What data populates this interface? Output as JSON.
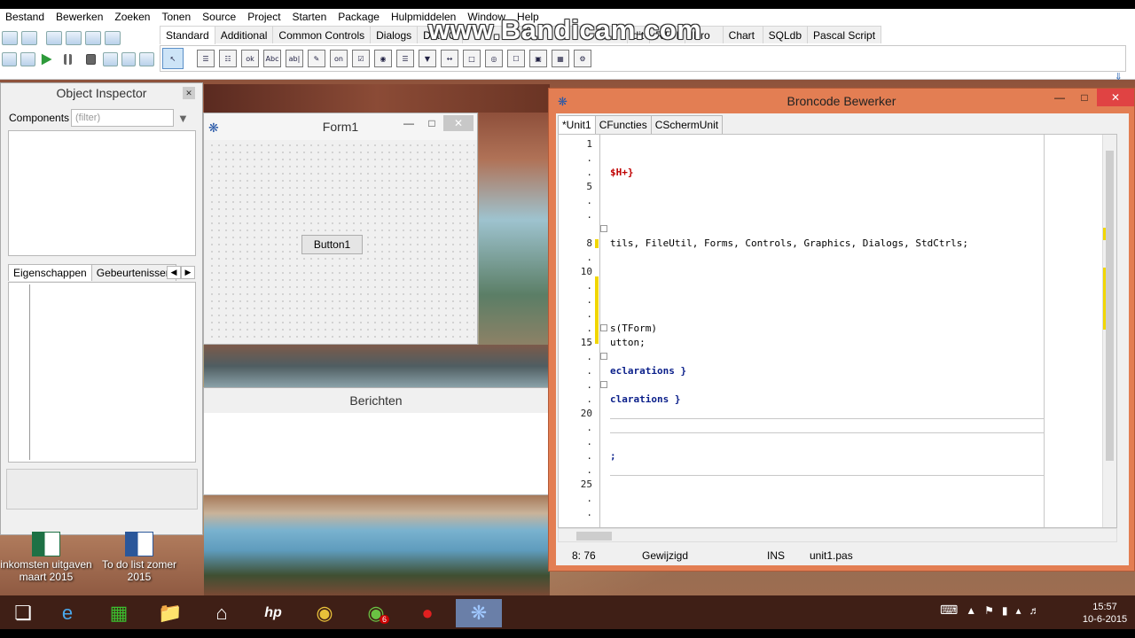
{
  "menu": [
    "Bestand",
    "Bewerken",
    "Zoeken",
    "Tonen",
    "Source",
    "Project",
    "Starten",
    "Package",
    "Hulpmiddelen",
    "Window",
    "Help"
  ],
  "watermark": "www.Bandicam.com",
  "palette_tabs": [
    "Standard",
    "Additional",
    "Common Controls",
    "Dialogs",
    "Data C",
    "dit",
    "RTTI",
    "IPro",
    "Chart",
    "SQLdb",
    "Pascal Script"
  ],
  "palette_items": [
    "cursor",
    "menu",
    "popup",
    "ok",
    "Abc",
    "ab|",
    "memo",
    "on",
    "check",
    "radio",
    "list",
    "combo",
    "scroll",
    "group",
    "radiogrp",
    "checkgrp",
    "panel",
    "frame",
    "actlist"
  ],
  "object_inspector": {
    "title": "Object Inspector",
    "components_label": "Components",
    "filter_placeholder": "(filter)",
    "tabs": [
      "Eigenschappen",
      "Gebeurtenissen"
    ]
  },
  "form1": {
    "title": "Form1",
    "button_label": "Button1"
  },
  "messages": {
    "title": "Berichten"
  },
  "editor": {
    "title": "Broncode Bewerker",
    "tabs": [
      "*Unit1",
      "CFuncties",
      "CSchermUnit"
    ],
    "line_numbers": [
      "1",
      ".",
      ".",
      "5",
      ".",
      ".",
      "8",
      ".",
      "10",
      ".",
      ".",
      ".",
      ".",
      ".",
      "15",
      ".",
      ".",
      ".",
      ".",
      "20",
      ".",
      ".",
      ".",
      ".",
      "25",
      ".",
      "."
    ],
    "lines": {
      "l3": "$H+}",
      "l8": "tils, FileUtil, Forms, Controls, Graphics, Dialogs, StdCtrls;",
      "l14": "s(TForm)",
      "l15": "utton;",
      "l17": "eclarations }",
      "l19": "clarations }",
      "l23": ";"
    },
    "status": {
      "position": "8: 76",
      "modified": "Gewijzigd",
      "mode": "INS",
      "file": "unit1.pas"
    }
  },
  "desktop_icons": [
    {
      "label": "inkomsten uitgaven maart 2015",
      "type": "excel"
    },
    {
      "label": "To do list zomer 2015",
      "type": "word"
    }
  ],
  "taskbar": {
    "apps": [
      "start",
      "internet-explorer",
      "store",
      "file-explorer",
      "home",
      "hp",
      "chrome",
      "spotify",
      "bandicam-record",
      "lazarus"
    ],
    "spotify_badge": "6",
    "time": "15:57",
    "date": "10-6-2015"
  },
  "colors": {
    "editor_frame": "#e37e53",
    "close_red": "#e04343",
    "keyword_red": "#c00000",
    "keyword_blue": "#0a1f8a",
    "taskbar": "#3f1f16"
  }
}
